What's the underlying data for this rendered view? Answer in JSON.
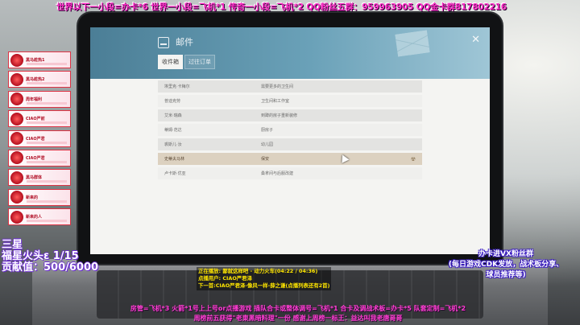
{
  "top_banner": "世界以下一小段=办卡*6  世界一小段=飞机*1  传奇一小段=飞机*2  QQ粉丝五群：959963905  QQ金卡群817802216",
  "mail_window": {
    "title": "邮件",
    "close_label": "✕",
    "tabs": [
      {
        "label": "收件箱"
      },
      {
        "label": "过往订单"
      }
    ],
    "rows": [
      {
        "sender": "埃里克·卡梅尔",
        "subject": "需要更多的卫生间"
      },
      {
        "sender": "普迪克劳",
        "subject": "卫生间和工作室"
      },
      {
        "sender": "艾米·瑞森",
        "subject": "到蹲的房子重新装修"
      },
      {
        "sender": "蒂姆·范达",
        "subject": "厨房子"
      },
      {
        "sender": "裘斯儿·汝",
        "subject": "幼儿园"
      },
      {
        "sender": "史蒂夫马林",
        "subject": "保安"
      },
      {
        "sender": "卢卡斯·优亚",
        "subject": "桑拿间与后服改建"
      }
    ],
    "selected_row_flag": "☢"
  },
  "left_ranks": [
    {
      "label": "黑马趁热1"
    },
    {
      "label": "黑马趁热2"
    },
    {
      "label": "周年福利"
    },
    {
      "label": "CIAO严前"
    },
    {
      "label": "CIAO严君"
    },
    {
      "label": "CIAO严君"
    },
    {
      "label": "黑马群体"
    },
    {
      "label": "新来的"
    },
    {
      "label": "新来的人"
    }
  ],
  "left_stats": {
    "line1": "三星",
    "line2": "福星火头ε 1/15",
    "line3": "贡献值：500/6000"
  },
  "right_notice": {
    "line1": "办卡进VX粉丝群",
    "line2": "(每日游戏CDK发放，战术板分享、",
    "line3": "球员推荐等)"
  },
  "music": {
    "line1": "正在播放: 鄙就这样吧 - 动力火车(04:22 / 04:36)",
    "line2": "点播用户: CIAO严君泽",
    "line3": "下一首:CIAO严君泽-像风一样-薛之谦(点播列表还有2首)"
  },
  "bottom_banner": {
    "line1": "房管=飞机*3  火箭*1号上上号or点播游戏  插队合卡或整体调号=飞机*1  合卡及调战术板=办卡*5  队套定制=飞机*2",
    "line2": "周榜前五获得\"老東黑暗料理\"一份        感谢上周榜一标王：益达叫我老唐哥哥"
  },
  "colors": {
    "header_accent": "#4b7e96",
    "selected_row": "#dcd1c0",
    "banner_pink": "#ff2ec8",
    "music_yellow": "#ffe600"
  }
}
